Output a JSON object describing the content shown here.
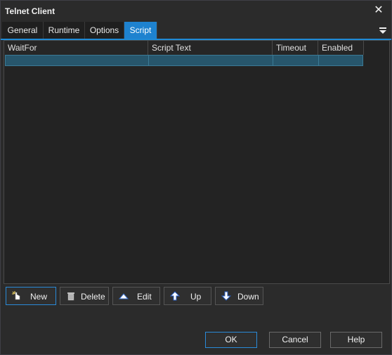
{
  "window": {
    "title": "Telnet Client"
  },
  "tabs": [
    {
      "label": "General"
    },
    {
      "label": "Runtime"
    },
    {
      "label": "Options"
    },
    {
      "label": "Script",
      "active": true
    }
  ],
  "grid": {
    "columns": [
      "WaitFor",
      "Script Text",
      "Timeout",
      "Enabled"
    ],
    "rows": [
      {
        "WaitFor": "",
        "Script Text": "",
        "Timeout": "",
        "Enabled": ""
      }
    ]
  },
  "actions": {
    "new": "New",
    "delete": "Delete",
    "edit": "Edit",
    "up": "Up",
    "down": "Down"
  },
  "footer": {
    "ok": "OK",
    "cancel": "Cancel",
    "help": "Help"
  },
  "icons": {
    "close": "close-icon",
    "tab_menu": "menu-icon",
    "new": "new-icon",
    "delete": "delete-icon",
    "edit": "edit-icon",
    "up": "arrow-up-icon",
    "down": "arrow-down-icon"
  },
  "colors": {
    "accent": "#1e82cf",
    "selected_row": "#27566c",
    "background": "#2b2b2b"
  }
}
